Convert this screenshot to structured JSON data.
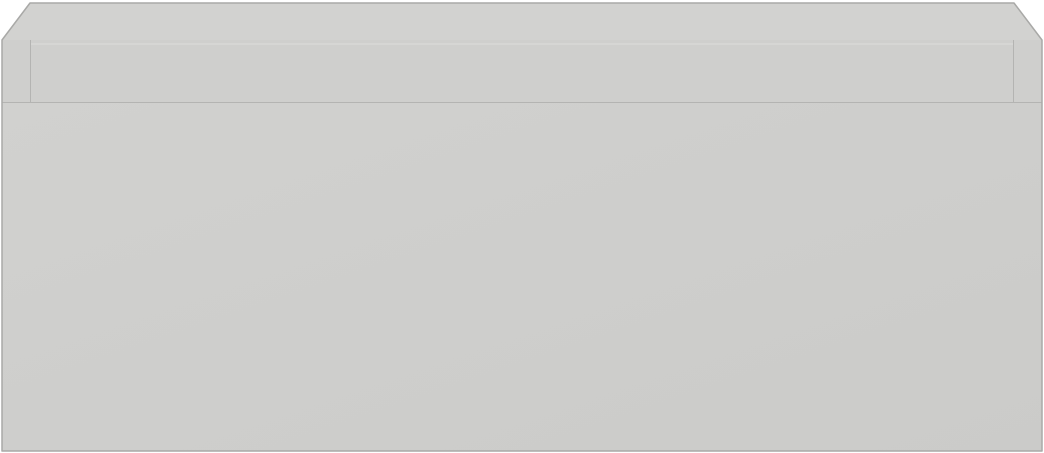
{
  "object": {
    "kind": "drawer-box",
    "colors": {
      "front_face": "#cbcbc9",
      "front_face_light": "#d1d1cf",
      "top_rim": "#d2d2d0",
      "inner_back_wall": "#c3c3c1",
      "inner_side_wall_left": "#bcbcba",
      "inner_side_wall_right": "#bdbdbb",
      "rail": "#cfcfcd",
      "rail_highlight": "#dededc",
      "edge_line": "#b4b4b2",
      "outline": "#a9a9a7"
    }
  }
}
